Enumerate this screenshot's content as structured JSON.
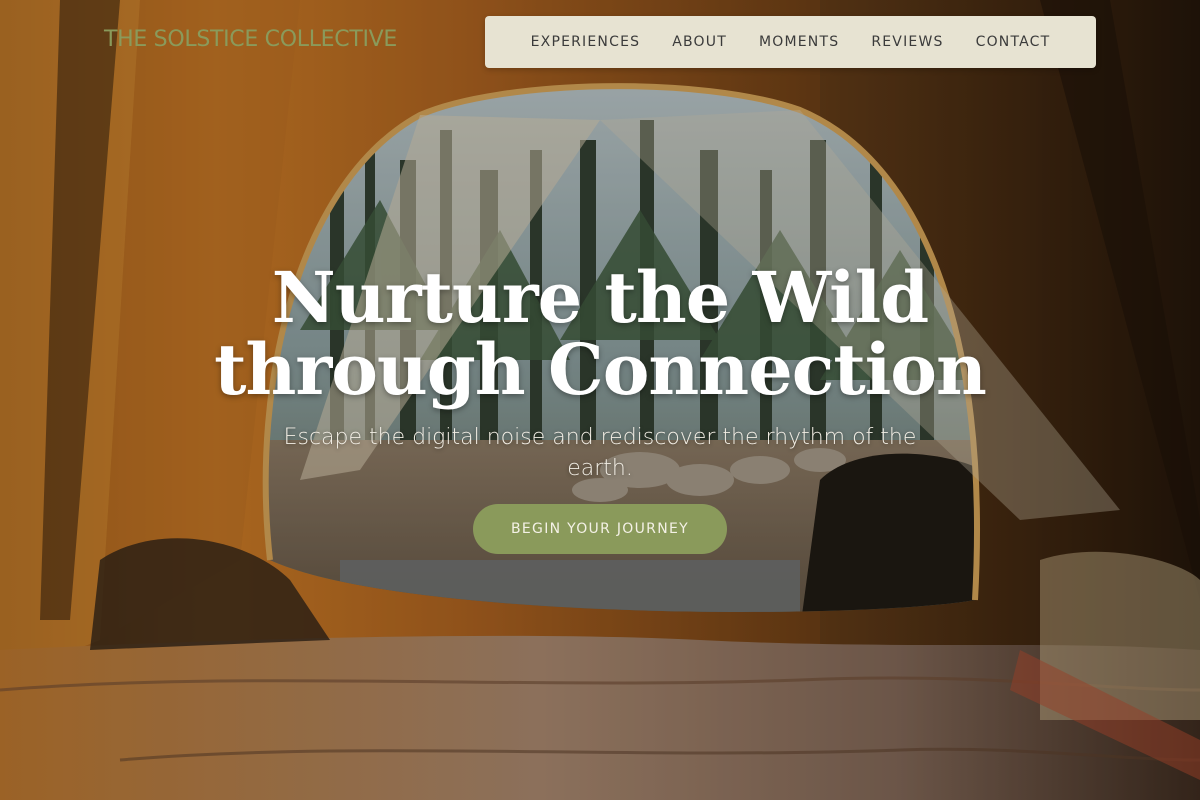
{
  "brand": {
    "name": "THE SOLSTICE COLLECTIVE",
    "color": "#8a9a5b"
  },
  "nav": {
    "items": [
      {
        "label": "EXPERIENCES"
      },
      {
        "label": "ABOUT"
      },
      {
        "label": "MOMENTS"
      },
      {
        "label": "REVIEWS"
      },
      {
        "label": "CONTACT"
      }
    ],
    "background": "#e7e3d2"
  },
  "hero": {
    "title_line1": "Nurture the Wild",
    "title_line2": "through Connection",
    "subtitle": "Escape the digital noise and rediscover the rhythm of the earth.",
    "cta_label": "BEGIN YOUR JOURNEY",
    "cta_color": "#8a9a5b"
  }
}
